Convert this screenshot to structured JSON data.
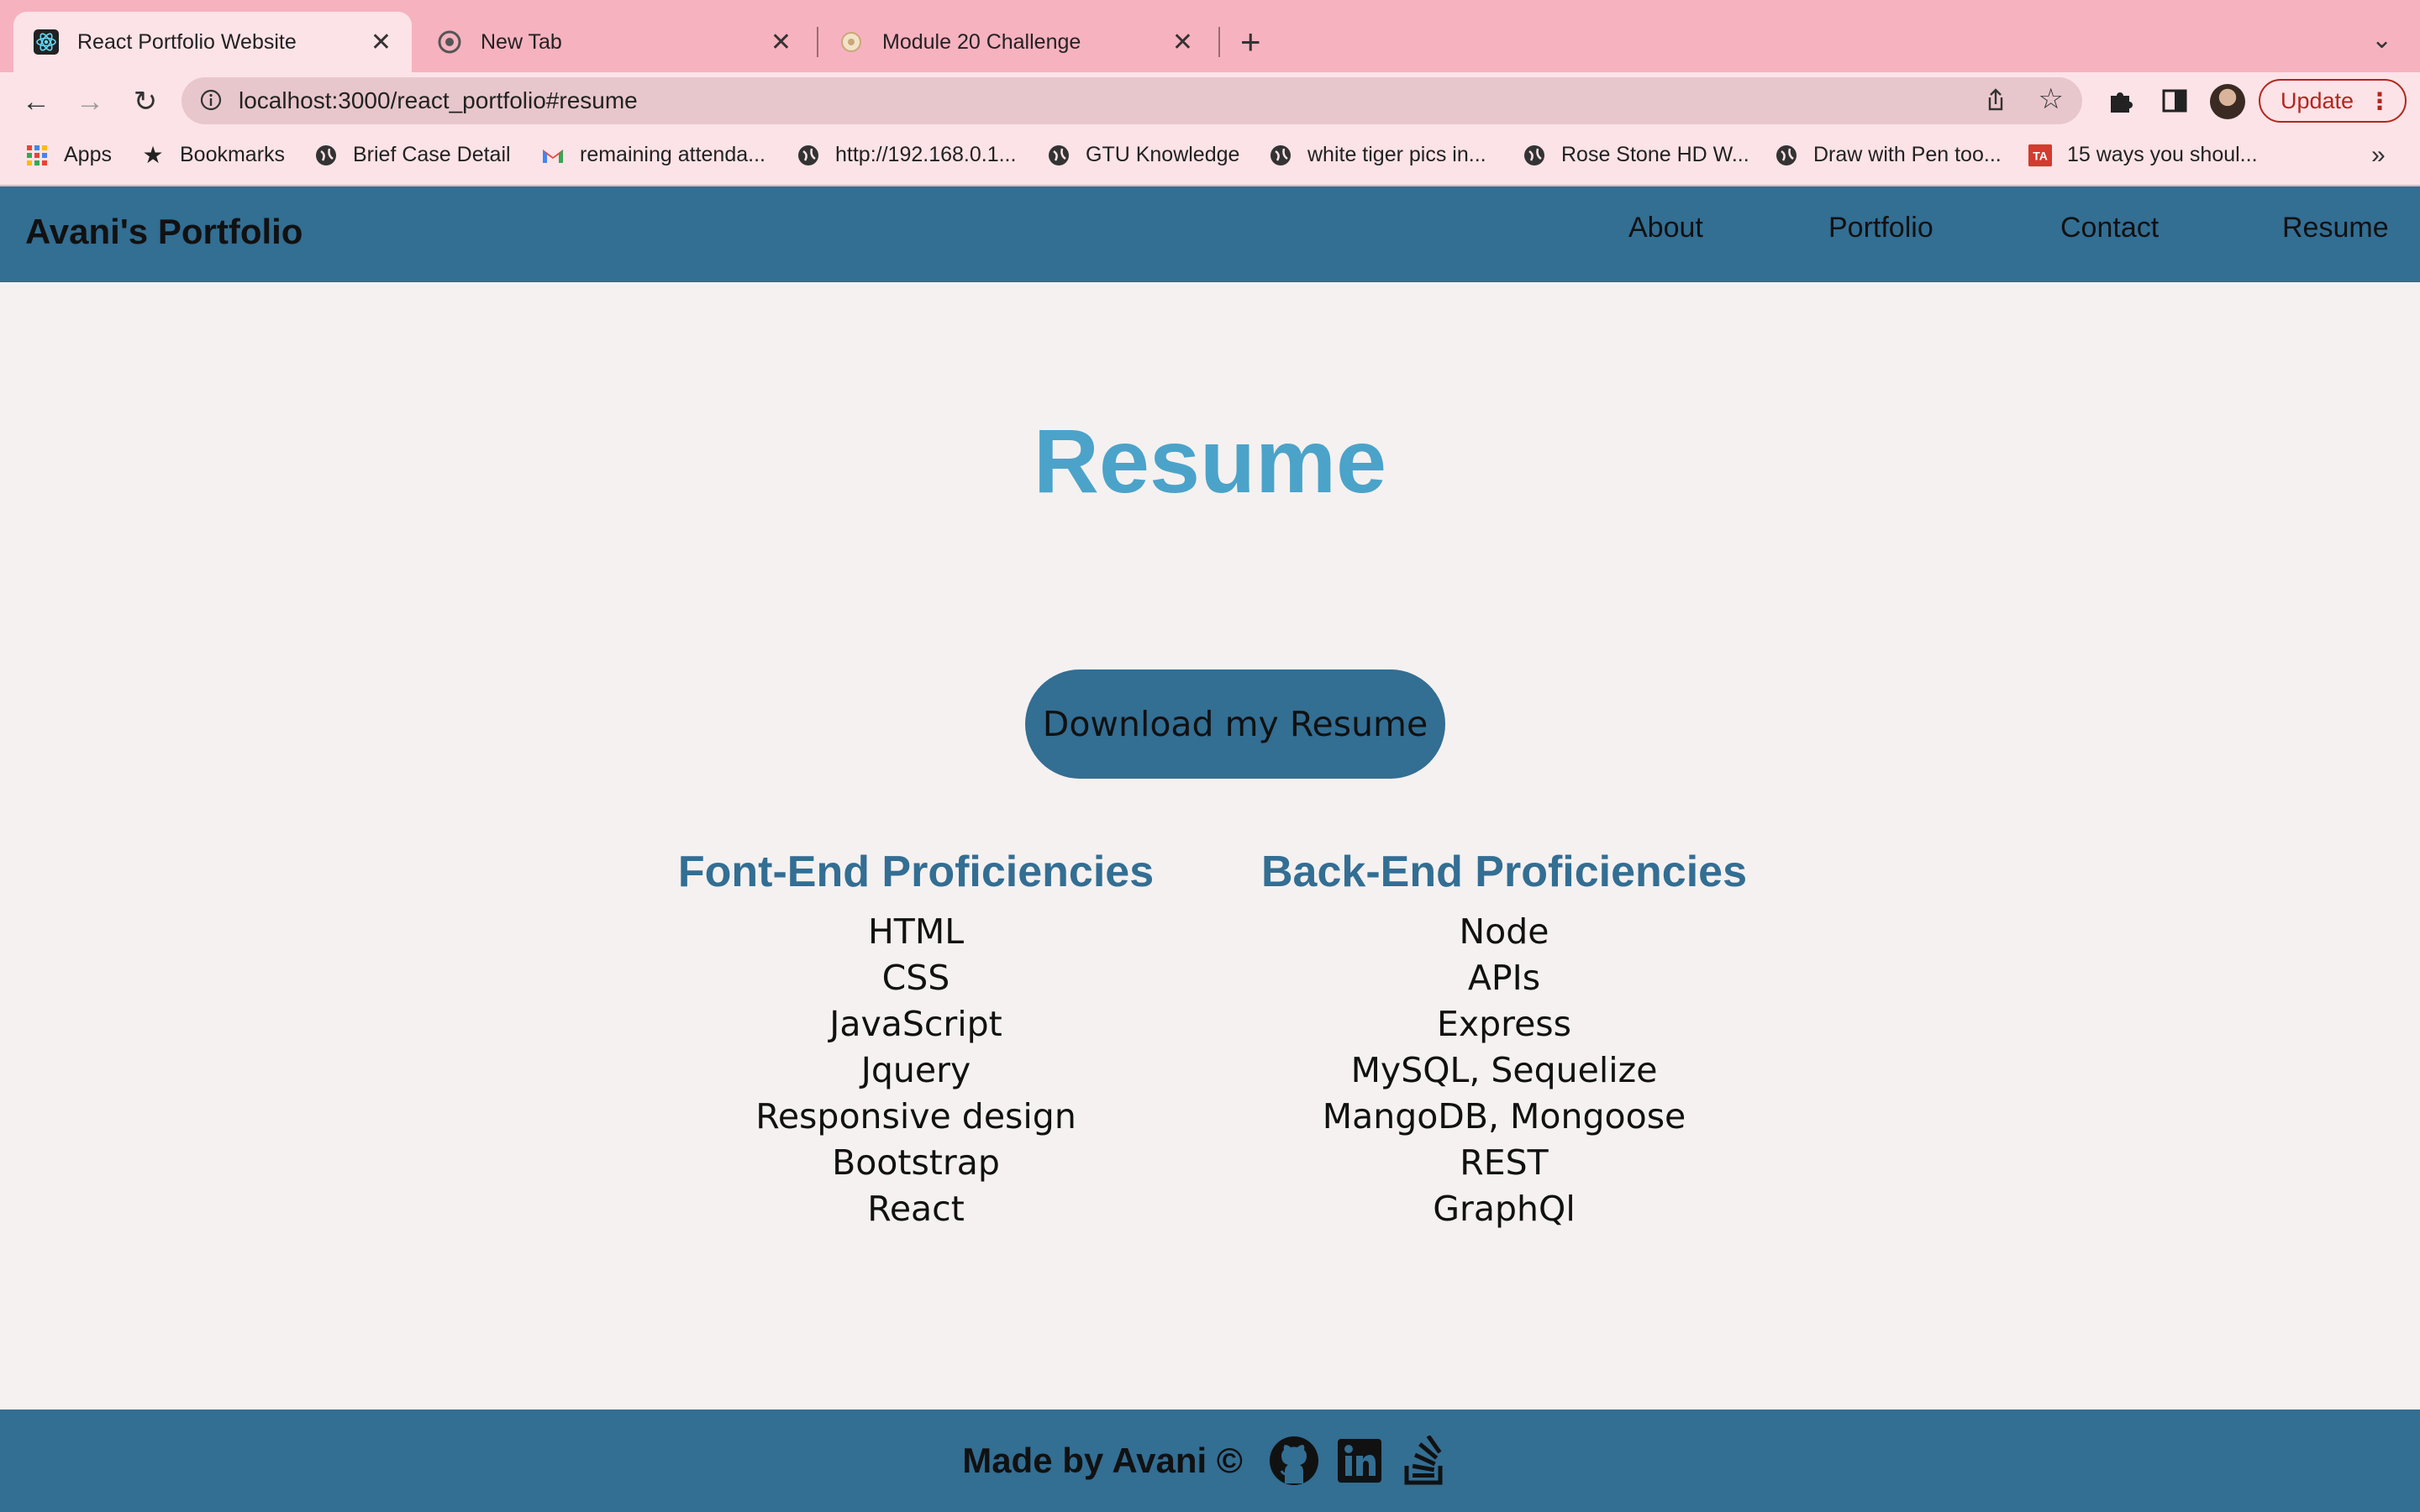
{
  "browser": {
    "tabs": [
      {
        "title": "React Portfolio Website",
        "icon": "react-icon",
        "active": true
      },
      {
        "title": "New Tab",
        "icon": "chrome-icon",
        "active": false
      },
      {
        "title": "Module 20 Challenge",
        "icon": "module-favicon",
        "active": false
      }
    ],
    "url": "localhost:3000/react_portfolio#resume",
    "update_label": "Update",
    "bookmarks": [
      {
        "label": "Apps",
        "icon": "apps-grid-icon"
      },
      {
        "label": "Bookmarks",
        "icon": "star-icon"
      },
      {
        "label": "Brief Case Detail",
        "icon": "globe-icon"
      },
      {
        "label": "remaining attenda...",
        "icon": "gmail-icon"
      },
      {
        "label": "http://192.168.0.1...",
        "icon": "globe-icon"
      },
      {
        "label": "GTU Knowledge",
        "icon": "globe-icon"
      },
      {
        "label": "white tiger pics in...",
        "icon": "globe-icon"
      },
      {
        "label": "Rose Stone HD W...",
        "icon": "globe-icon"
      },
      {
        "label": "Draw with Pen too...",
        "icon": "globe-icon"
      },
      {
        "label": "15 ways you shoul...",
        "icon": "ta-icon"
      }
    ]
  },
  "site": {
    "brand": "Avani's Portfolio",
    "nav": [
      "About",
      "Portfolio",
      "Contact",
      "Resume"
    ]
  },
  "resume": {
    "title": "Resume",
    "download_label": "Download my Resume",
    "frontend": {
      "heading": "Font-End Proficiencies",
      "items": [
        "HTML",
        "CSS",
        "JavaScript",
        "Jquery",
        "Responsive design",
        "Bootstrap",
        "React"
      ]
    },
    "backend": {
      "heading": "Back-End Proficiencies",
      "items": [
        "Node",
        "APIs",
        "Express",
        "MySQL, Sequelize",
        "MangoDB, Mongoose",
        "REST",
        "GraphQl"
      ]
    }
  },
  "footer": {
    "text": "Made by Avani ©",
    "links": [
      "github-icon",
      "linkedin-icon",
      "stackoverflow-icon"
    ]
  },
  "colors": {
    "header_bg": "#336e93",
    "title": "#4ba3c9",
    "heading": "#336e93",
    "page_bg": "#f5f1f0",
    "tabstrip": "#f6b2bf"
  }
}
